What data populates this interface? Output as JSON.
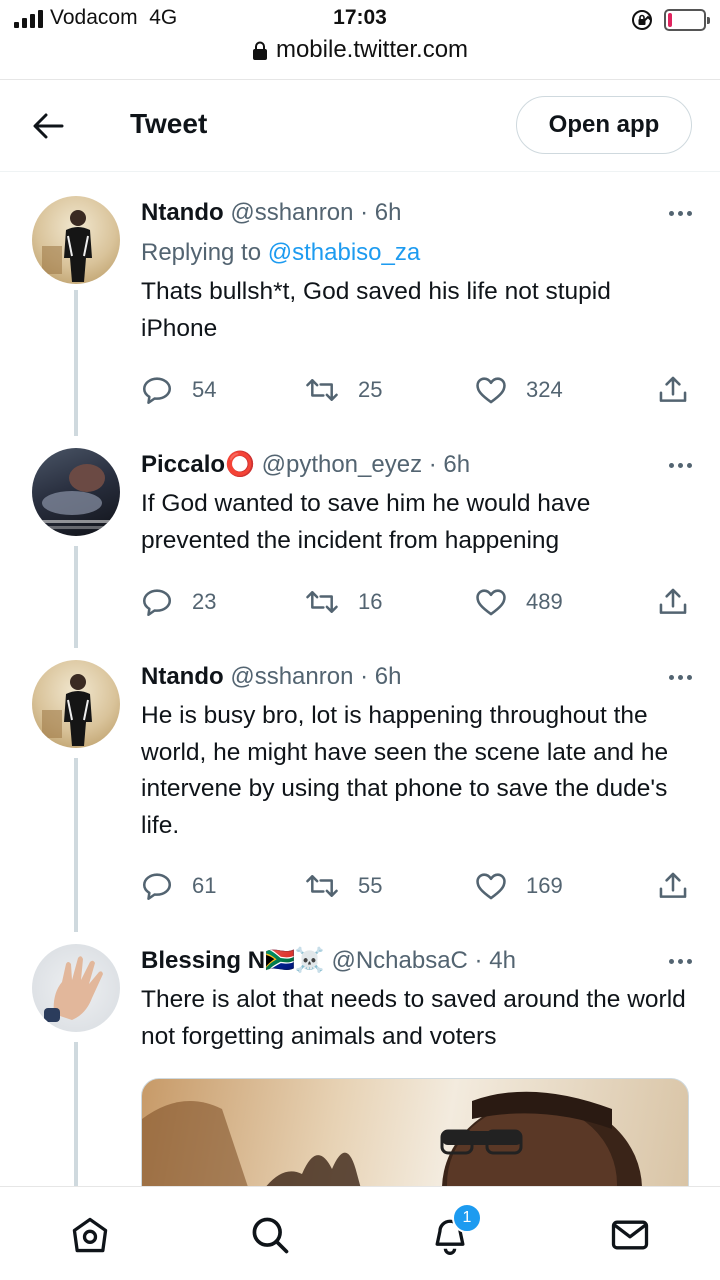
{
  "status_bar": {
    "carrier": "Vodacom",
    "network": "4G",
    "time": "17:03",
    "url": "mobile.twitter.com"
  },
  "header": {
    "back_icon": "arrow-left-icon",
    "title": "Tweet",
    "open_app_label": "Open app"
  },
  "tweets": [
    {
      "name": "Ntando",
      "handle": "@sshanron",
      "time": "6h",
      "replying_label": "Replying to",
      "replying_to": "@sthabiso_za",
      "text": "Thats bullsh*t, God saved his life not stupid iPhone",
      "replies": "54",
      "retweets": "25",
      "likes": "324"
    },
    {
      "name": "Piccalo",
      "name_emoji": "⭕",
      "handle": "@python_eyez",
      "time": "6h",
      "text": "If God wanted to save him he would have prevented the incident from happening",
      "replies": "23",
      "retweets": "16",
      "likes": "489"
    },
    {
      "name": "Ntando",
      "handle": "@sshanron",
      "time": "6h",
      "text": "He is busy bro, lot is happening throughout the world, he might have seen the scene late and he intervene by using that phone to save the dude's life.",
      "replies": "61",
      "retweets": "55",
      "likes": "169"
    },
    {
      "name": "Blessing N",
      "name_emoji": "🇿🇦☠️",
      "handle": "@NchabsaC",
      "time": "4h",
      "text": "There is alot that needs to saved around the world not forgetting animals  and voters"
    }
  ],
  "bottom_nav": {
    "items": [
      "home-icon",
      "search-icon",
      "notifications-icon",
      "messages-icon"
    ],
    "notification_count": "1"
  },
  "colors": {
    "accent": "#1d9bf0",
    "text": "#0f1419",
    "secondary": "#536471",
    "thread_line": "#cfd9de",
    "battery_low": "#e0245e"
  }
}
